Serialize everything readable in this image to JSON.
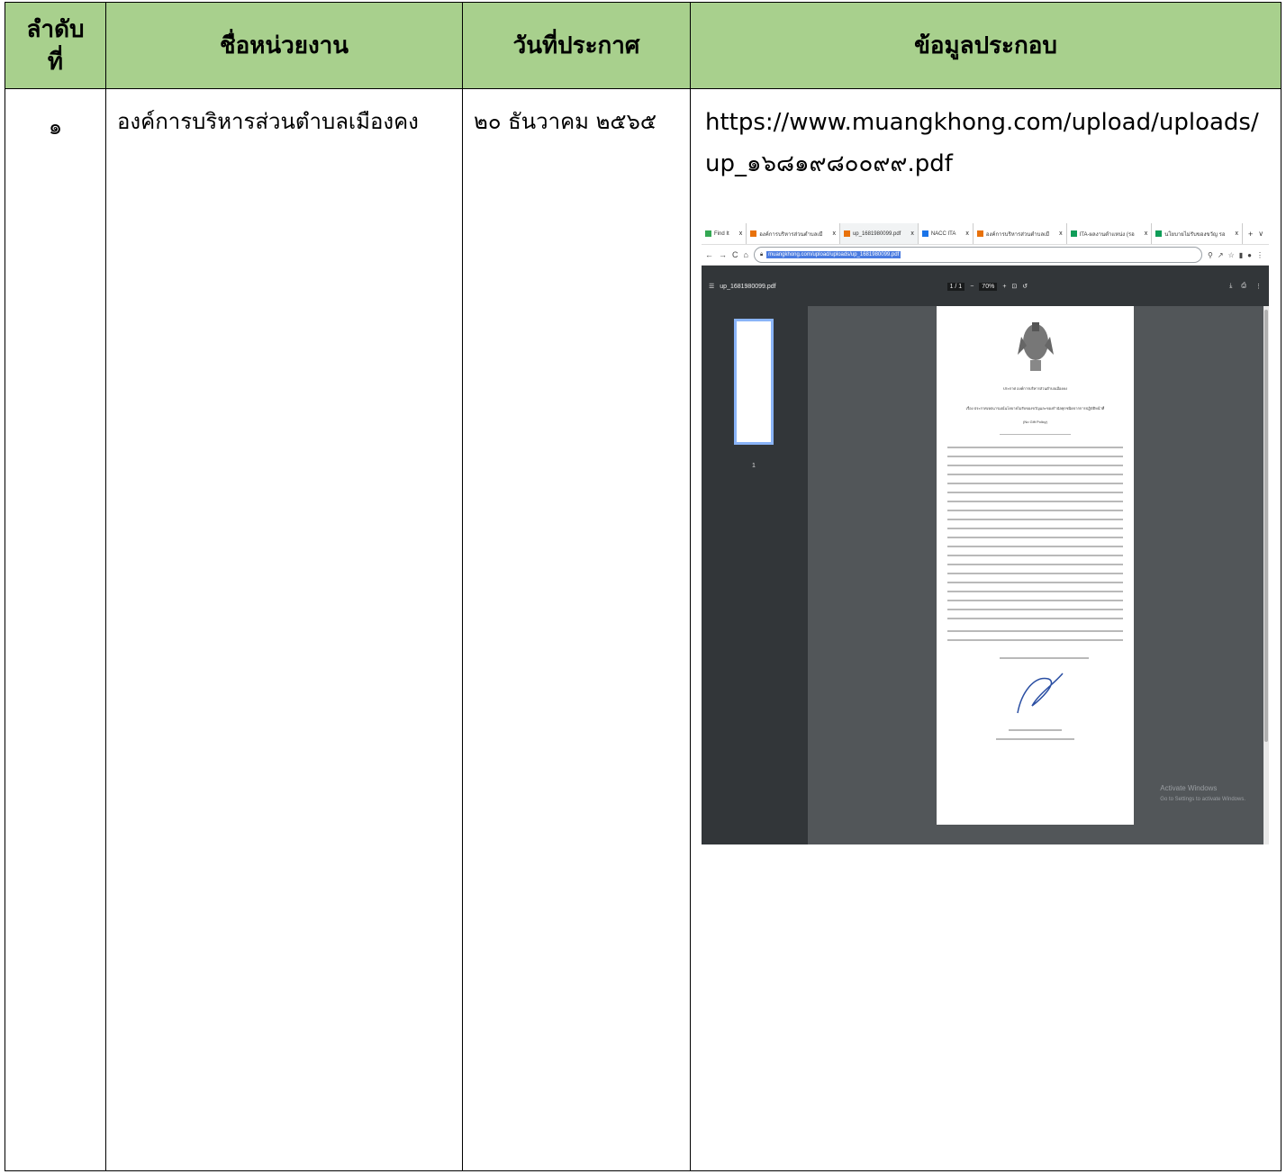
{
  "table": {
    "headers": [
      "ลำดับ\nที่",
      "ชื่อหน่วยงาน",
      "วันที่ประกาศ",
      "ข้อมูลประกอบ"
    ],
    "row": {
      "number": "๑",
      "agency": "องค์การบริหารส่วนตำบลเมืองคง",
      "date": "๒๐ ธันวาคม ๒๕๖๕",
      "link": "https://www.muangkhong.com/upload/uploads/up_๑๖๘๑๙๘๐๐๙๙.pdf"
    }
  },
  "screenshot": {
    "tabs": [
      "Find It",
      "องค์การบริหารส่วนตำบลเมื",
      "up_1681980099.pdf",
      "NACC ITA",
      "องค์การบริหารส่วนตำบลเมื",
      "ITA-ผลงานตำแหน่ง (รอ",
      "นโยบายไม่รับของขวัญ รอ"
    ],
    "new_tab": "+",
    "url": "muangkhong.com/upload/uploads/up_1681980099.pdf",
    "pdf_title": "up_1681980099.pdf",
    "page_indicator": "1 / 1",
    "zoom": "70%",
    "thumb_page": "1",
    "doc_heading": "ประกาศ องค์การบริหารส่วนตำบลเมืองคง",
    "doc_subject": "เรื่อง ประกาศเจตนารมณ์นโยบายไม่รับของขวัญและของกำนัลทุกชนิดจากการปฏิบัติหน้าที่",
    "doc_policy": "(No Gift Policy)",
    "watermark_title": "Activate Windows",
    "watermark_sub": "Go to Settings to activate Windows."
  }
}
